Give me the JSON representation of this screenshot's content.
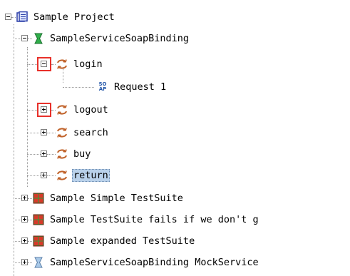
{
  "tree": {
    "project": {
      "label": "Sample Project",
      "icon": "project-icon"
    },
    "binding": {
      "label": "SampleServiceSoapBinding",
      "icon": "soap-binding-icon"
    },
    "operations": [
      {
        "label": "login",
        "icon": "operation-icon",
        "expanded": true,
        "highlighted": true
      },
      {
        "label": "logout",
        "icon": "operation-icon",
        "expanded": false,
        "highlighted": true
      },
      {
        "label": "search",
        "icon": "operation-icon",
        "expanded": false
      },
      {
        "label": "buy",
        "icon": "operation-icon",
        "expanded": false
      },
      {
        "label": "return",
        "icon": "operation-icon",
        "expanded": false,
        "selected": true
      }
    ],
    "request": {
      "label": "Request 1",
      "icon_text_top": "SO",
      "icon_text_bottom": "AP"
    },
    "testsuites": [
      {
        "label": "Sample Simple TestSuite",
        "icon": "testsuite-icon"
      },
      {
        "label": "Sample TestSuite fails if we don't g",
        "icon": "testsuite-icon"
      },
      {
        "label": "Sample expanded TestSuite",
        "icon": "testsuite-icon"
      }
    ],
    "mockservice": {
      "label": "SampleServiceSoapBinding MockService",
      "icon": "mockservice-icon"
    }
  },
  "colors": {
    "highlight_border": "#e8302a",
    "selection_bg": "#b9d1ea",
    "operation_icon": "#c0622a",
    "binding_icon": "#1f8a3a",
    "testsuite_icon": "#c0392b",
    "project_icon": "#2a3ea8"
  }
}
